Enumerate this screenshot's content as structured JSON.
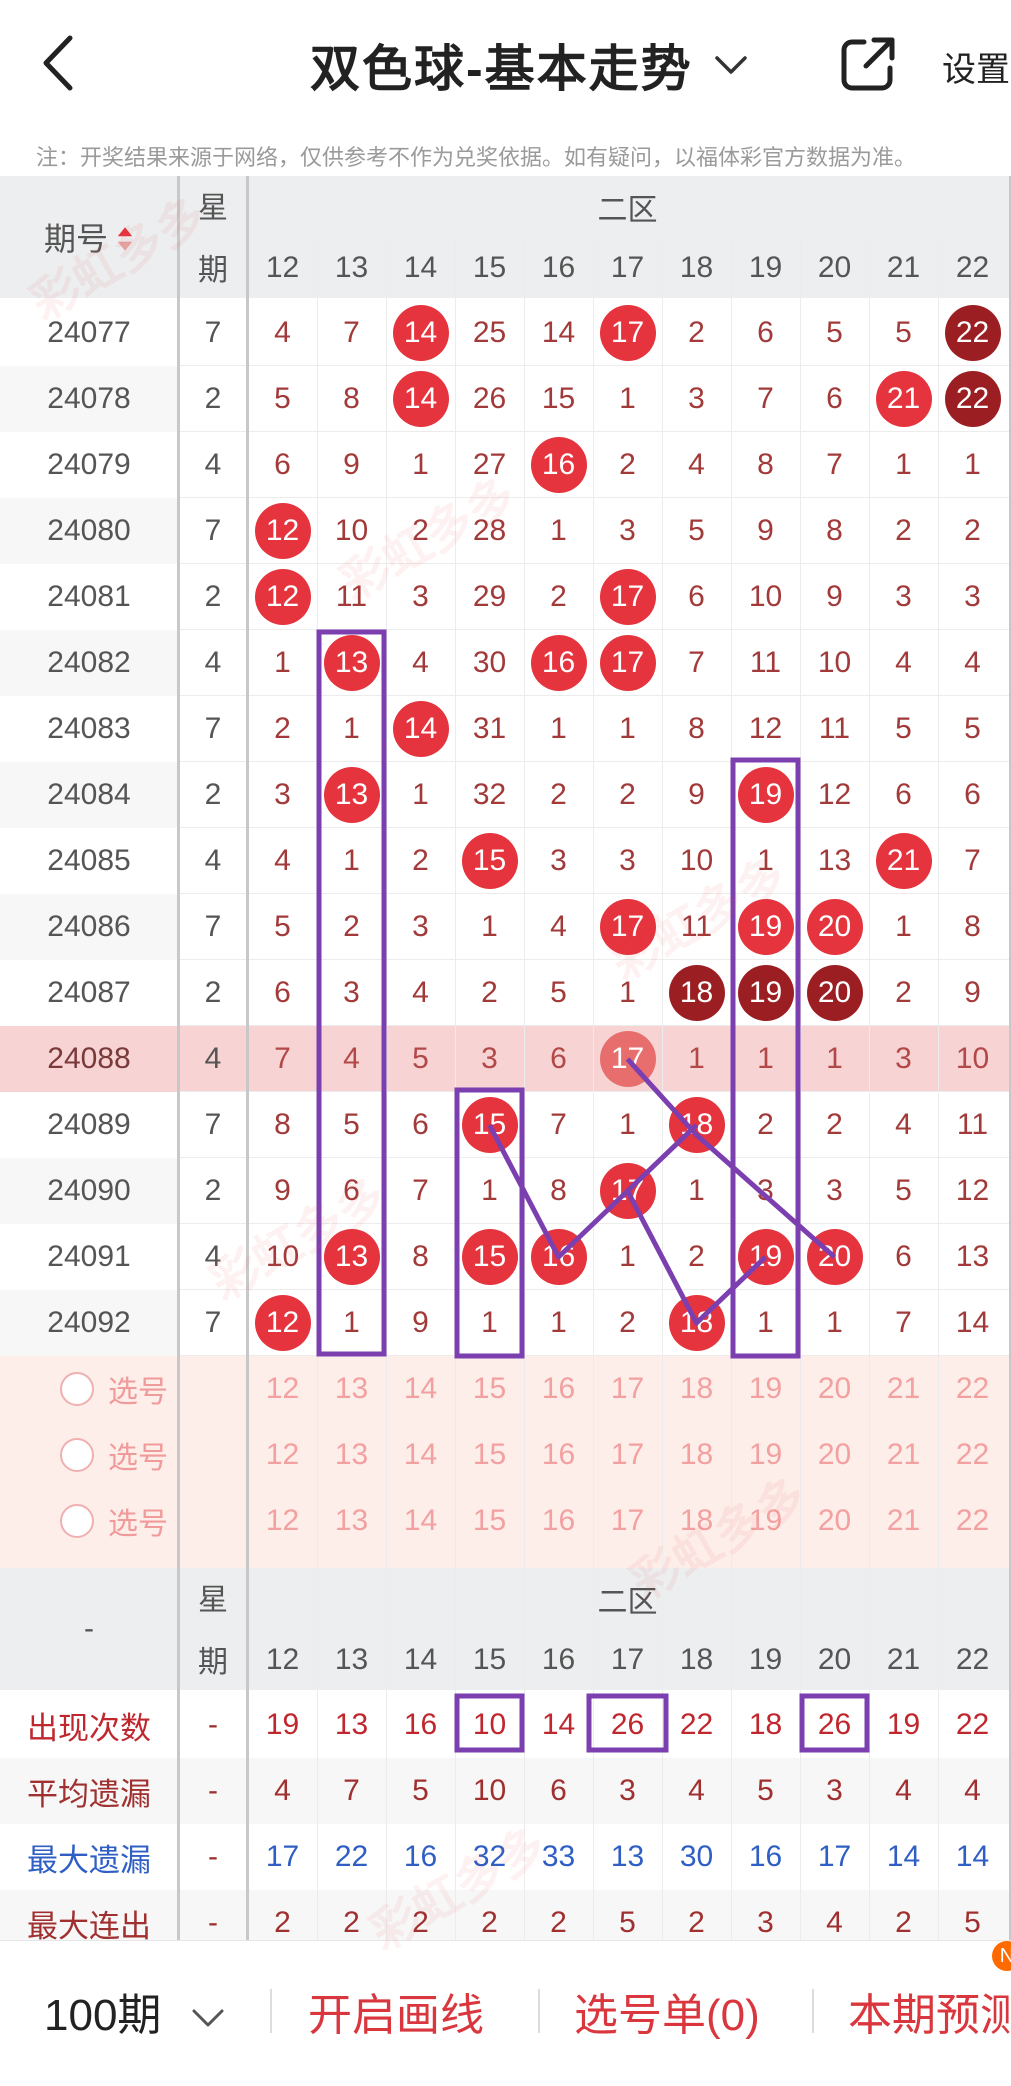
{
  "header": {
    "title": "双色球-基本走势",
    "settings_label": "设置",
    "notice": "注：开奖结果来源于网络，仅供参考不作为兑奖依据。如有疑问，以福体彩官方数据为准。"
  },
  "table": {
    "col_issue_label": "期号",
    "col_week_label_1": "星",
    "col_week_label_2": "期",
    "zone_label": "二区",
    "numbers": [
      "12",
      "13",
      "14",
      "15",
      "16",
      "17",
      "18",
      "19",
      "20",
      "21",
      "22"
    ],
    "rows": [
      {
        "issue": "24077",
        "week": "7",
        "cells": [
          "4",
          "7",
          "14",
          "25",
          "14",
          "17",
          "2",
          "6",
          "5",
          "5",
          "22"
        ],
        "balls": [
          2,
          5
        ],
        "dark": [
          10
        ],
        "highlight": false
      },
      {
        "issue": "24078",
        "week": "2",
        "cells": [
          "5",
          "8",
          "14",
          "26",
          "15",
          "1",
          "3",
          "7",
          "6",
          "21",
          "22"
        ],
        "balls": [
          2,
          9
        ],
        "dark": [
          10
        ],
        "highlight": false
      },
      {
        "issue": "24079",
        "week": "4",
        "cells": [
          "6",
          "9",
          "1",
          "27",
          "16",
          "2",
          "4",
          "8",
          "7",
          "1",
          "1"
        ],
        "balls": [
          4
        ],
        "dark": [],
        "highlight": false
      },
      {
        "issue": "24080",
        "week": "7",
        "cells": [
          "12",
          "10",
          "2",
          "28",
          "1",
          "3",
          "5",
          "9",
          "8",
          "2",
          "2"
        ],
        "balls": [
          0
        ],
        "dark": [],
        "highlight": false
      },
      {
        "issue": "24081",
        "week": "2",
        "cells": [
          "12",
          "11",
          "3",
          "29",
          "2",
          "17",
          "6",
          "10",
          "9",
          "3",
          "3"
        ],
        "balls": [
          0,
          5
        ],
        "dark": [],
        "highlight": false
      },
      {
        "issue": "24082",
        "week": "4",
        "cells": [
          "1",
          "13",
          "4",
          "30",
          "16",
          "17",
          "7",
          "11",
          "10",
          "4",
          "4"
        ],
        "balls": [
          1,
          4,
          5
        ],
        "dark": [],
        "highlight": false
      },
      {
        "issue": "24083",
        "week": "7",
        "cells": [
          "2",
          "1",
          "14",
          "31",
          "1",
          "1",
          "8",
          "12",
          "11",
          "5",
          "5"
        ],
        "balls": [
          2
        ],
        "dark": [],
        "highlight": false
      },
      {
        "issue": "24084",
        "week": "2",
        "cells": [
          "3",
          "13",
          "1",
          "32",
          "2",
          "2",
          "9",
          "19",
          "12",
          "6",
          "6"
        ],
        "balls": [
          1,
          7
        ],
        "dark": [],
        "highlight": false
      },
      {
        "issue": "24085",
        "week": "4",
        "cells": [
          "4",
          "1",
          "2",
          "15",
          "3",
          "3",
          "10",
          "1",
          "13",
          "21",
          "7"
        ],
        "balls": [
          3,
          9
        ],
        "dark": [],
        "highlight": false
      },
      {
        "issue": "24086",
        "week": "7",
        "cells": [
          "5",
          "2",
          "3",
          "1",
          "4",
          "17",
          "11",
          "19",
          "20",
          "1",
          "8"
        ],
        "balls": [
          5,
          7,
          8
        ],
        "dark": [],
        "highlight": false
      },
      {
        "issue": "24087",
        "week": "2",
        "cells": [
          "6",
          "3",
          "4",
          "2",
          "5",
          "1",
          "18",
          "19",
          "20",
          "2",
          "9"
        ],
        "balls": [],
        "dark": [
          6,
          7,
          8
        ],
        "highlight": false
      },
      {
        "issue": "24088",
        "week": "4",
        "cells": [
          "7",
          "4",
          "5",
          "3",
          "6",
          "17",
          "1",
          "1",
          "1",
          "3",
          "10"
        ],
        "balls": [],
        "dark": [],
        "faded": [
          5
        ],
        "highlight": true
      },
      {
        "issue": "24089",
        "week": "7",
        "cells": [
          "8",
          "5",
          "6",
          "15",
          "7",
          "1",
          "18",
          "2",
          "2",
          "4",
          "11"
        ],
        "balls": [
          3,
          6
        ],
        "dark": [],
        "highlight": false
      },
      {
        "issue": "24090",
        "week": "2",
        "cells": [
          "9",
          "6",
          "7",
          "1",
          "8",
          "17",
          "1",
          "3",
          "3",
          "5",
          "12"
        ],
        "balls": [
          5
        ],
        "dark": [],
        "highlight": false
      },
      {
        "issue": "24091",
        "week": "4",
        "cells": [
          "10",
          "13",
          "8",
          "15",
          "16",
          "1",
          "2",
          "19",
          "20",
          "6",
          "13"
        ],
        "balls": [
          1,
          3,
          4,
          7,
          8
        ],
        "dark": [],
        "highlight": false
      },
      {
        "issue": "24092",
        "week": "7",
        "cells": [
          "12",
          "1",
          "9",
          "1",
          "1",
          "2",
          "18",
          "1",
          "1",
          "7",
          "14"
        ],
        "balls": [
          0,
          6
        ],
        "dark": [],
        "highlight": false
      }
    ],
    "select_label": "选号",
    "select_rows": 3
  },
  "stats": {
    "dash": "-",
    "col_week_label_1": "星",
    "col_week_label_2": "期",
    "zone_label": "二区",
    "rows": [
      {
        "label": "出现次数",
        "color": "#c0262d",
        "week": "-",
        "values": [
          "19",
          "13",
          "16",
          "10",
          "14",
          "26",
          "22",
          "18",
          "26",
          "19",
          "22"
        ]
      },
      {
        "label": "平均遗漏",
        "color": "#a03030",
        "week": "-",
        "values": [
          "4",
          "7",
          "5",
          "10",
          "6",
          "3",
          "4",
          "5",
          "3",
          "4",
          "4"
        ]
      },
      {
        "label": "最大遗漏",
        "color": "#2f5fc4",
        "week": "-",
        "values": [
          "17",
          "22",
          "16",
          "32",
          "33",
          "13",
          "30",
          "16",
          "17",
          "14",
          "14"
        ]
      },
      {
        "label": "最大连出",
        "color": "#a03030",
        "week": "-",
        "values": [
          "2",
          "2",
          "2",
          "2",
          "2",
          "5",
          "2",
          "3",
          "4",
          "2",
          "5"
        ]
      }
    ]
  },
  "bottom": {
    "period": "100期",
    "draw_line": "开启画线",
    "selection_list": "选号单(0)",
    "prediction": "本期预测",
    "badge": "N"
  },
  "colors": {
    "accent_red": "#e5343d",
    "dark_red": "#9b1f22",
    "highlight_row": "#f7d3d3",
    "purple": "#7b3fb0",
    "blue_text": "#2f5fc4"
  }
}
